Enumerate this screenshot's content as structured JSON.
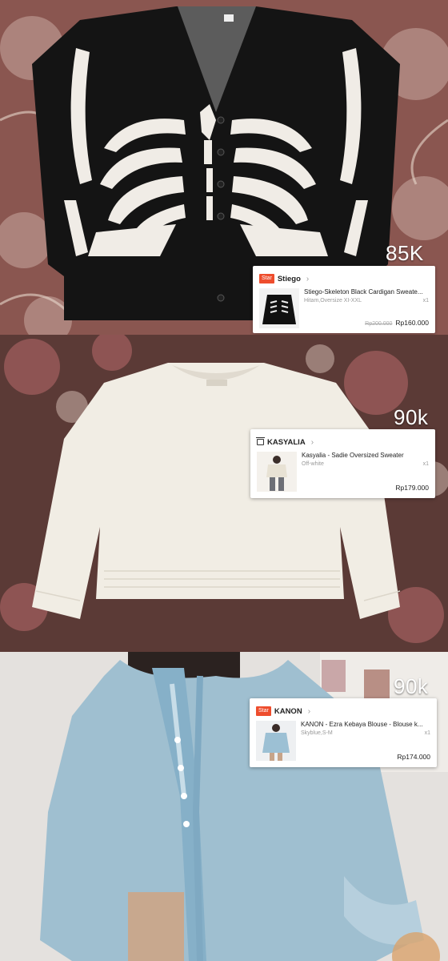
{
  "posts": [
    {
      "price_label": "85K",
      "card": {
        "badge": "Star",
        "shop": "Stiego",
        "product": "Stiego-Skeleton Black Cardigan Sweate...",
        "variant": "Hitam,Oversize XI-XXL",
        "qty": "x1",
        "old_price": "Rp200.000",
        "price": "Rp160.000"
      }
    },
    {
      "price_label": "90k",
      "card": {
        "shop": "KASYALIA",
        "shop_icon": "store-icon",
        "product": "Kasyalia - Sadie Oversized Sweater",
        "variant": "Off-white",
        "qty": "x1",
        "price": "Rp179.000"
      }
    },
    {
      "price_label": "90k",
      "card": {
        "badge": "Star",
        "shop": "KANON",
        "product": "KANON - Ezra Kebaya Blouse - Blouse k...",
        "variant": "Skyblue,S-M",
        "qty": "x1",
        "price": "Rp174.000"
      }
    }
  ],
  "colors": {
    "badge": "#ee4d2d",
    "chevron": "#999999"
  }
}
